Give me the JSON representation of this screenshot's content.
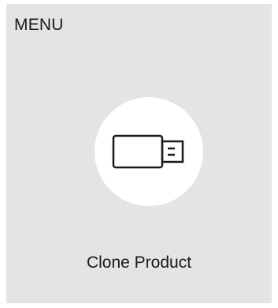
{
  "menu": {
    "title": "MENU"
  },
  "item": {
    "icon": "usb-drive-icon",
    "label": "Clone Product"
  },
  "colors": {
    "panel_background": "#e4e4e4",
    "icon_background": "#ffffff",
    "text": "#1a1a1a"
  }
}
